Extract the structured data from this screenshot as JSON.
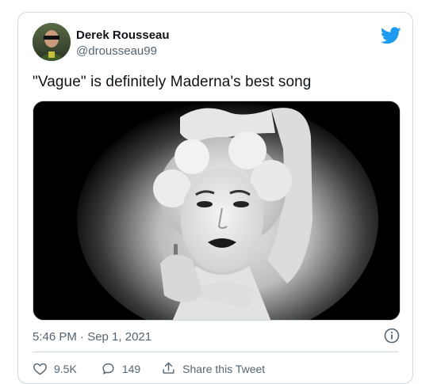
{
  "tweet": {
    "author_name": "Derek Rousseau",
    "author_handle": "@drousseau99",
    "text": "\"Vague\" is definitely Maderna's best song",
    "timestamp": "5:46 PM · Sep 1, 2021",
    "media_description_icon": "photo",
    "brand_icon": "twitter-bird-icon",
    "brand_color": "#1d9bf0"
  },
  "actions": {
    "likes": "9.5K",
    "replies": "149",
    "share_label": "Share this Tweet"
  },
  "colors": {
    "text": "#0f1419",
    "muted": "#536471",
    "border": "#cfd9de"
  }
}
